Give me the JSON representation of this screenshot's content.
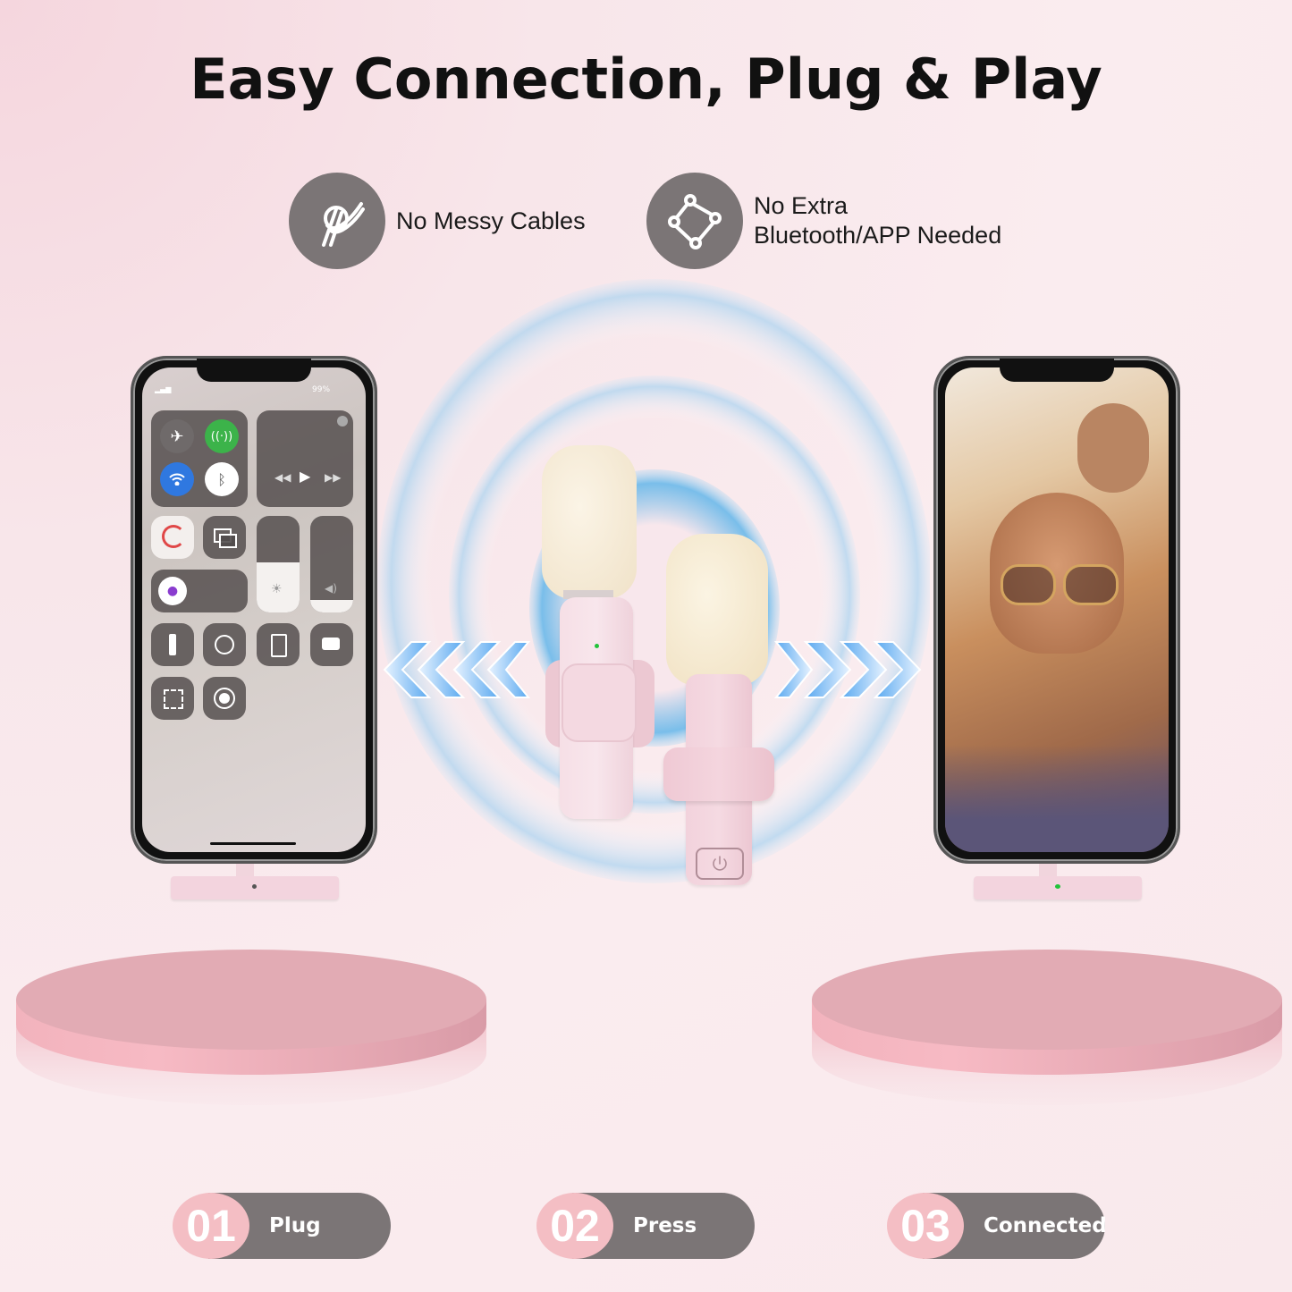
{
  "title": "Easy Connection, Plug & Play",
  "features": [
    {
      "icon": "tangled-cable-icon",
      "text": "No Messy Cables"
    },
    {
      "icon": "network-nodes-icon",
      "line1": "No Extra",
      "line2": "Bluetooth/APP Needed"
    }
  ],
  "left_phone": {
    "status_bar": {
      "battery": "99%"
    },
    "control_center": [
      "airplane-mode",
      "cellular-data",
      "wifi",
      "bluetooth",
      "media-player",
      "rotation-lock",
      "screen-mirroring",
      "brightness",
      "volume",
      "focus",
      "flashlight",
      "timer",
      "calculator",
      "camera",
      "qr-scanner",
      "screen-record"
    ]
  },
  "right_phone": {
    "content": "selfie-photo"
  },
  "steps": [
    {
      "number": "01",
      "label": "Plug"
    },
    {
      "number": "02",
      "label": "Press"
    },
    {
      "number": "03",
      "label": "Connected"
    }
  ],
  "colors": {
    "icon_circle": "#7b7576",
    "step_pill": "#7b7576",
    "step_number_bg": "#f4bec4",
    "platform": "#e3aab4",
    "mic_body": "#f4d8e0",
    "mic_foam": "#f5ead6",
    "led_green": "#22c33a"
  }
}
